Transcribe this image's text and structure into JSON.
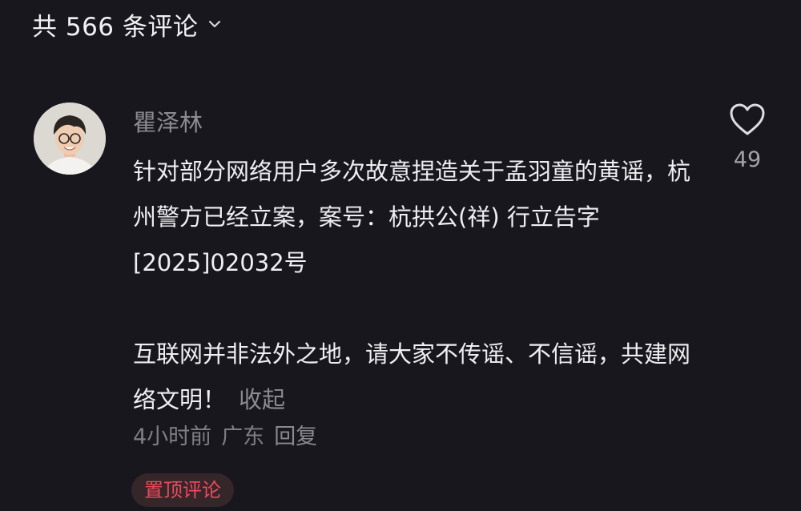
{
  "header": {
    "comment_count_label": "共 566 条评论",
    "dropdown_icon": "chevron-down-icon"
  },
  "comment": {
    "username": "瞿泽林",
    "avatar_icon": "user-avatar",
    "paragraph_1": "针对部分网络用户多次故意捏造关于孟羽童的黄谣，杭州警方已经立案，案号：杭拱公(祥) 行立告字[2025]02032号",
    "paragraph_2": "互联网并非法外之地，请大家不传谣、不信谣，共建网络文明！",
    "collapse_label": "收起",
    "time": "4小时前",
    "location": "广东",
    "reply_label": "回复",
    "pinned_badge": "置顶评论",
    "like_icon": "heart-outline-icon",
    "like_count": "49"
  },
  "colors": {
    "background": "#18171d",
    "text_primary": "#efeef2",
    "text_secondary": "#8c8b92",
    "pinned_text": "#ee4a5c",
    "pinned_bg": "#35262a"
  }
}
